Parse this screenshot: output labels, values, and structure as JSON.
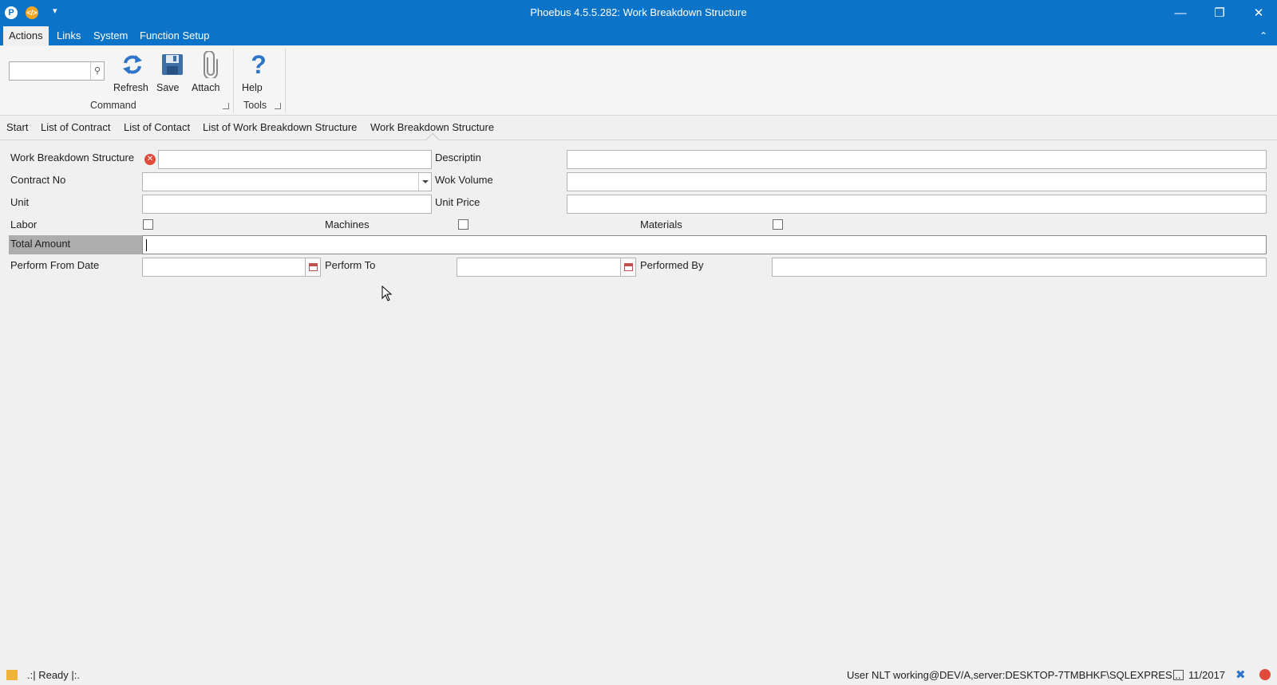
{
  "window": {
    "title": "Phoebus 4.5.5.282: Work Breakdown Structure",
    "app_icon_1": "P",
    "app_icon_2": "</>",
    "quick_access": "▾",
    "minimize": "—",
    "restore": "❐",
    "close": "✕"
  },
  "menu": {
    "items": [
      "Actions",
      "Links",
      "System",
      "Function Setup"
    ],
    "collapse": "⌃"
  },
  "ribbon": {
    "search_value": "",
    "buttons": {
      "refresh": "Refresh",
      "save": "Save",
      "attach": "Attach",
      "help": "Help"
    },
    "groups": {
      "command": "Command",
      "tools": "Tools"
    }
  },
  "nav": {
    "items": [
      "Start",
      "List of Contract",
      "List of Contact",
      "List of Work Breakdown Structure",
      "Work Breakdown Structure"
    ]
  },
  "form": {
    "labels": {
      "wbs": "Work Breakdown Structure",
      "description": "Descriptin",
      "contract_no": "Contract No",
      "work_volume": "Wok Volume",
      "unit": "Unit",
      "unit_price": "Unit Price",
      "labor": "Labor",
      "machines": "Machines",
      "materials": "Materials",
      "total_amount": "Total Amount",
      "perform_from": "Perform From Date",
      "perform_to": "Perform To",
      "performed_by": "Performed By"
    },
    "values": {
      "wbs": "",
      "description": "",
      "contract_no": "",
      "work_volume": "",
      "unit": "",
      "unit_price": "",
      "total_amount": "",
      "perform_from": "",
      "perform_to": "",
      "performed_by": ""
    }
  },
  "status": {
    "ready": ".:| Ready |:.",
    "user": "User NLT working@DEV/A,server:DESKTOP-7TMBHKF\\SQLEXPRES...",
    "period": "11/2017"
  }
}
